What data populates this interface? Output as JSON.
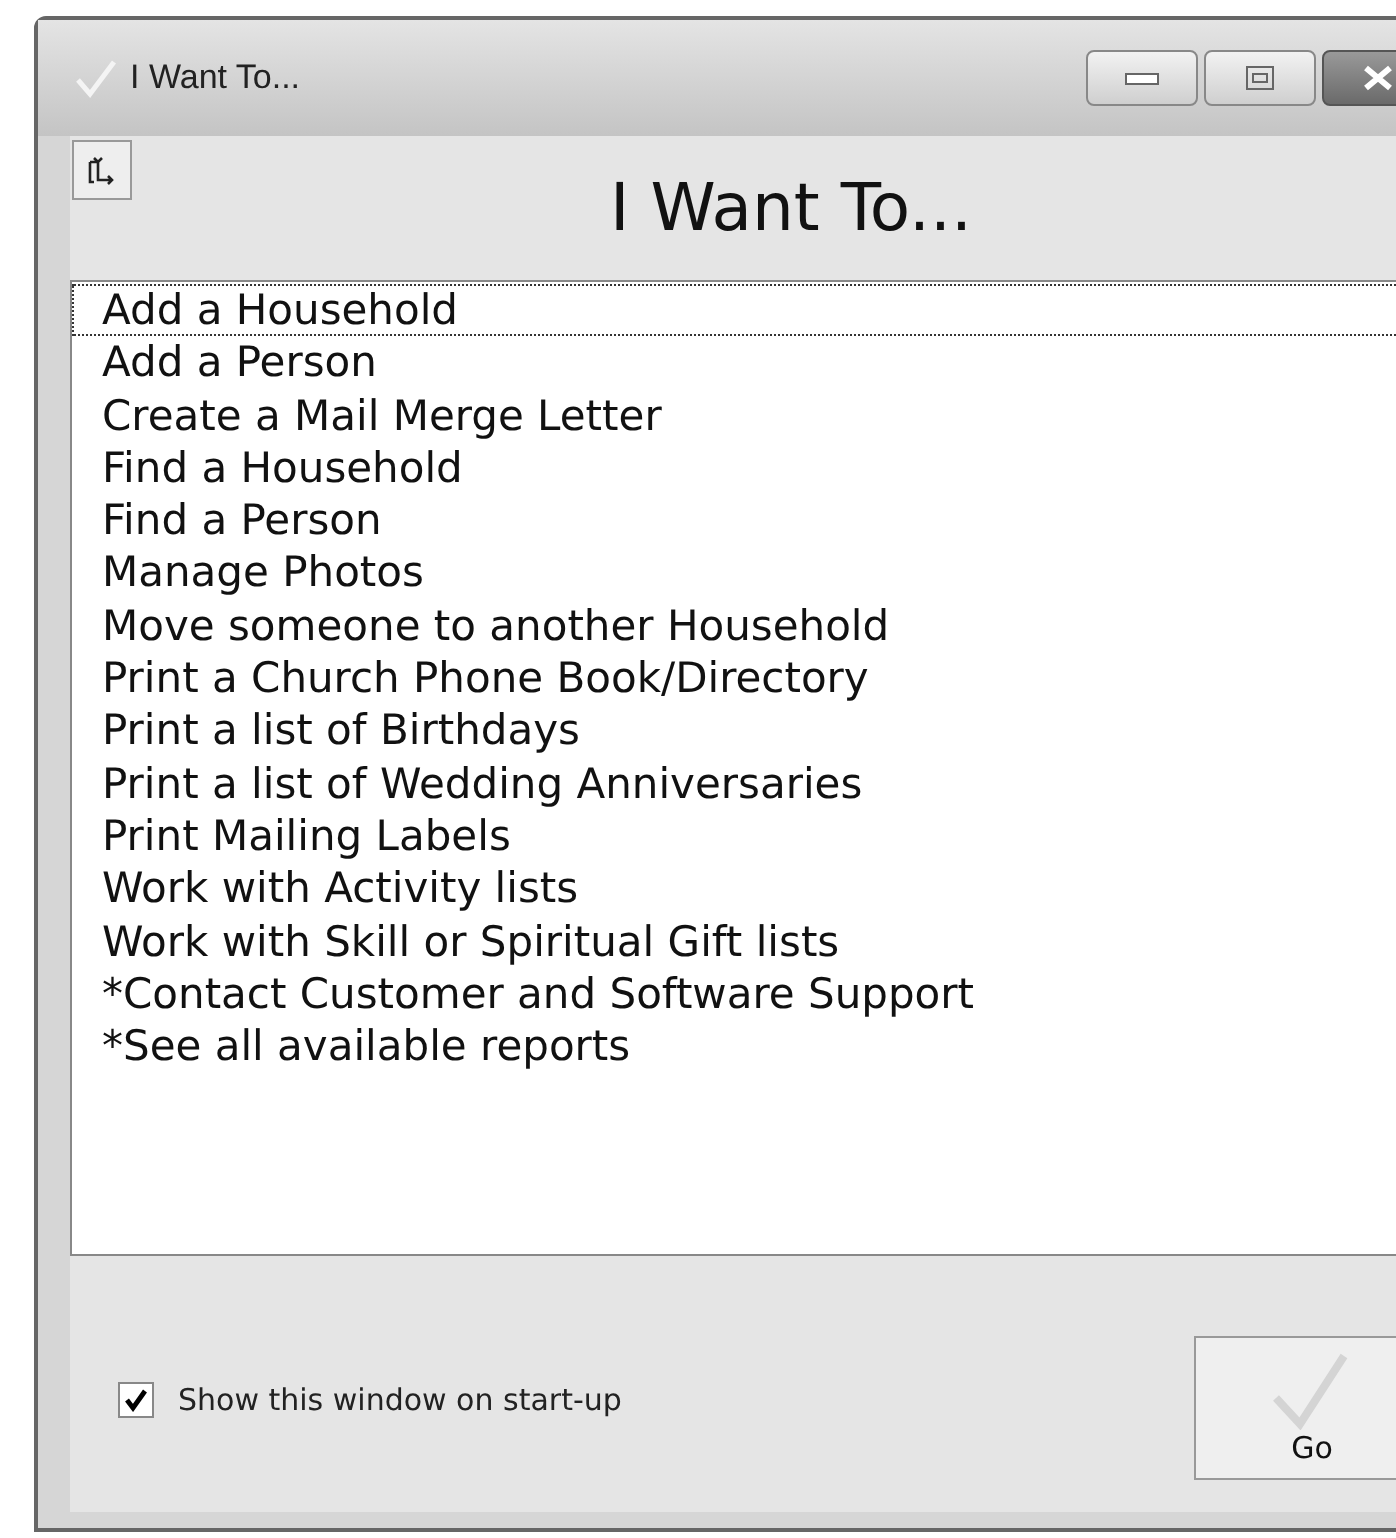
{
  "window": {
    "title": "I Want To..."
  },
  "heading": "I Want To...",
  "items": [
    {
      "label": "Add a Household",
      "selected": true
    },
    {
      "label": "Add a Person",
      "selected": false
    },
    {
      "label": "Create a Mail Merge Letter",
      "selected": false
    },
    {
      "label": "Find a Household",
      "selected": false
    },
    {
      "label": "Find a Person",
      "selected": false
    },
    {
      "label": "Manage Photos",
      "selected": false
    },
    {
      "label": "Move someone to another Household",
      "selected": false
    },
    {
      "label": "Print a Church Phone Book/Directory",
      "selected": false
    },
    {
      "label": "Print a list of Birthdays",
      "selected": false
    },
    {
      "label": "Print a list of Wedding Anniversaries",
      "selected": false
    },
    {
      "label": "Print Mailing Labels",
      "selected": false
    },
    {
      "label": "Work with Activity lists",
      "selected": false
    },
    {
      "label": "Work with Skill or Spiritual Gift lists",
      "selected": false
    },
    {
      "label": "*Contact Customer and Software Support",
      "selected": false
    },
    {
      "label": "*See all available reports",
      "selected": false
    }
  ],
  "startup_checkbox": {
    "label": "Show this window on start-up",
    "checked": true
  },
  "go_button": {
    "label": "Go"
  }
}
